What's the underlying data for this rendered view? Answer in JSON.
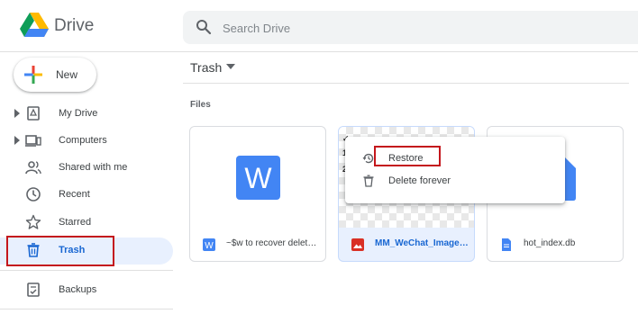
{
  "app": {
    "name": "Drive"
  },
  "search": {
    "placeholder": "Search Drive"
  },
  "sidebar": {
    "new_label": "New",
    "items": [
      {
        "label": "My Drive",
        "icon": "my-drive-icon"
      },
      {
        "label": "Computers",
        "icon": "computers-icon"
      },
      {
        "label": "Shared with me",
        "icon": "shared-icon"
      },
      {
        "label": "Recent",
        "icon": "clock-icon"
      },
      {
        "label": "Starred",
        "icon": "star-icon"
      },
      {
        "label": "Trash",
        "icon": "trash-icon",
        "selected": true
      },
      {
        "label": "Backups",
        "icon": "backups-icon"
      }
    ]
  },
  "main": {
    "title": "Trash",
    "section": "Files",
    "files": [
      {
        "name": "~$w to recover deleted files.docx",
        "type": "word-doc-icon",
        "preview_letter": "W"
      },
      {
        "name": "MM_WeChat_Image.png",
        "type": "image-icon",
        "selected": true
      },
      {
        "name": "hot_index.db",
        "type": "file-icon"
      }
    ]
  },
  "context_menu": {
    "items": [
      {
        "label": "Restore",
        "icon": "restore-icon"
      },
      {
        "label": "Delete forever",
        "icon": "trash-icon"
      }
    ]
  },
  "colors": {
    "accent": "#1967d2",
    "selected_bg": "#e8f0fe",
    "highlight_box": "#c4161c",
    "word_blue": "#4285f4",
    "image_red": "#d93025"
  }
}
